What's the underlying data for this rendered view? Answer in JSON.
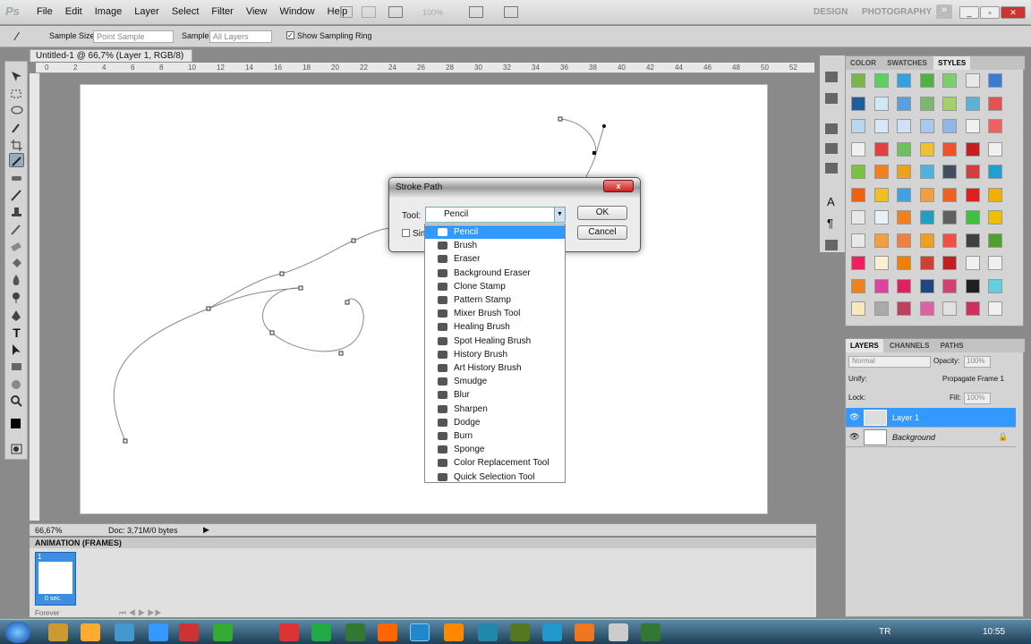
{
  "app": {
    "logo": "Ps",
    "menus": [
      "File",
      "Edit",
      "Image",
      "Layer",
      "Select",
      "Filter",
      "View",
      "Window",
      "Help"
    ],
    "zoom_combo": "100%",
    "workspaces": [
      "DESIGN",
      "PHOTOGRAPHY"
    ]
  },
  "options": {
    "sample_size_label": "Sample Size:",
    "sample_size_value": "Point Sample",
    "sample_label": "Sample:",
    "sample_value": "All Layers",
    "show_ring": "Show Sampling Ring"
  },
  "document": {
    "tab": "Untitled-1 @ 66,7% (Layer 1, RGB/8) *",
    "zoom": "66,67%",
    "doc_info": "Doc: 3,71M/0 bytes",
    "ruler_ticks": [
      "0",
      "2",
      "4",
      "6",
      "8",
      "10",
      "12",
      "14",
      "16",
      "18",
      "20",
      "22",
      "24",
      "26",
      "28",
      "30",
      "32",
      "34",
      "36",
      "38",
      "40",
      "42",
      "44",
      "46",
      "48",
      "50",
      "52"
    ]
  },
  "animation": {
    "title": "ANIMATION (FRAMES)",
    "frame_num": "1",
    "frame_time": "0 sec.",
    "loop": "Forever"
  },
  "dialog": {
    "title": "Stroke Path",
    "tool_label": "Tool:",
    "tool_value": "Pencil",
    "simulate_partial": "Sim",
    "ok": "OK",
    "cancel": "Cancel",
    "close": "x"
  },
  "dropdown": {
    "options": [
      "Pencil",
      "Brush",
      "Eraser",
      "Background Eraser",
      "Clone Stamp",
      "Pattern Stamp",
      "Mixer Brush Tool",
      "Healing Brush",
      "Spot Healing Brush",
      "History Brush",
      "Art History Brush",
      "Smudge",
      "Blur",
      "Sharpen",
      "Dodge",
      "Burn",
      "Sponge",
      "Color Replacement Tool",
      "Quick Selection Tool"
    ]
  },
  "swatches_panel": {
    "tabs": [
      "COLOR",
      "SWATCHES",
      "STYLES"
    ],
    "active": "STYLES"
  },
  "layers_panel": {
    "tabs": [
      "LAYERS",
      "CHANNELS",
      "PATHS"
    ],
    "blend": "Normal",
    "opacity_label": "Opacity:",
    "opacity": "100%",
    "unify": "Unify:",
    "propagate": "Propagate Frame 1",
    "lock": "Lock:",
    "fill_label": "Fill:",
    "fill": "100%",
    "layers": [
      "Layer 1",
      "Background"
    ]
  },
  "taskbar": {
    "lang": "TR",
    "time": "10:55"
  }
}
